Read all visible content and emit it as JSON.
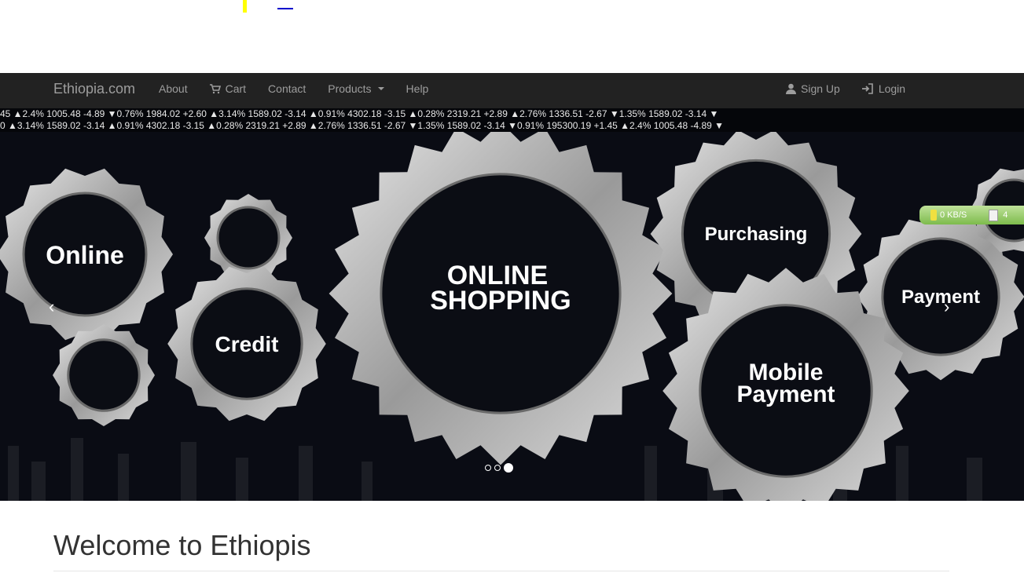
{
  "navbar": {
    "brand": "Ethiopia.com",
    "left_items": [
      "About",
      "Cart",
      "Contact",
      "Products",
      "Help"
    ],
    "right_items": [
      "Sign Up",
      "Login"
    ]
  },
  "ticker": {
    "row1": "45 ▲2.4%  1005.48 -4.89 ▼0.76%  1984.02 +2.60 ▲3.14%  1589.02 -3.14 ▲0.91%  4302.18 -3.15 ▲0.28%  2319.21 +2.89 ▲2.76%  1336.51 -2.67 ▼1.35%  1589.02 -3.14 ▼",
    "row2": "0 ▲3.14%  1589.02 -3.14 ▲0.91%  4302.18 -3.15 ▲0.28%  2319.21 +2.89 ▲2.76%  1336.51 -2.67 ▼1.35%  1589.02 -3.14 ▼0.91%  195300.19 +1.45 ▲2.4%  1005.48 -4.89 ▼"
  },
  "carousel": {
    "gear_labels": [
      "Online",
      "Credit",
      "ONLINE",
      "SHOPPING",
      "Purchasing",
      "Payment",
      "Mobile",
      "Payment"
    ],
    "prev": "‹",
    "next": "›",
    "slide_count": 3,
    "active_slide": 3
  },
  "widget": {
    "speed": "0 KB/S",
    "count": "4"
  },
  "main": {
    "heading": "Welcome to Ethiopis"
  },
  "colors": {
    "navbar_bg": "#222222",
    "nav_text": "#9d9d9d",
    "hero_bg": "#0a0c14"
  }
}
